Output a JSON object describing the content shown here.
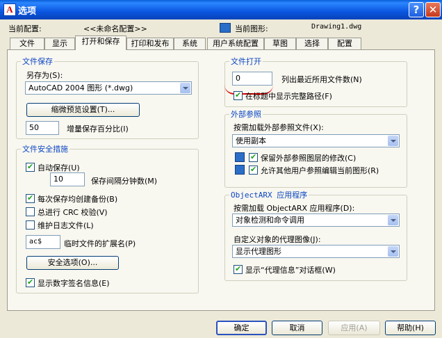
{
  "window": {
    "title": "选项",
    "icon_letter": "A"
  },
  "header": {
    "current_profile_label": "当前配置:",
    "current_profile_value": "<<未命名配置>>",
    "current_drawing_label": "当前图形:",
    "current_drawing_value": "Drawing1.dwg"
  },
  "tabs": [
    "文件",
    "显示",
    "打开和保存",
    "打印和发布",
    "系统",
    "用户系统配置",
    "草图",
    "选择",
    "配置"
  ],
  "file_save": {
    "title": "文件保存",
    "save_as_label": "另存为(S):",
    "save_as_value": "AutoCAD 2004 图形 (*.dwg)",
    "thumbnail_button": "缩微预览设置(T)...",
    "incremental_value": "50",
    "incremental_label": "增量保存百分比(I)"
  },
  "file_safety": {
    "title": "文件安全措施",
    "autosave_label": "自动保存(U)",
    "autosave_checked": true,
    "minutes_value": "10",
    "minutes_label": "保存间隔分钟数(M)",
    "backup_label": "每次保存均创建备份(B)",
    "backup_checked": true,
    "crc_label": "总进行 CRC 校验(V)",
    "crc_checked": false,
    "log_label": "维护日志文件(L)",
    "log_checked": false,
    "temp_ext_value": "ac$",
    "temp_ext_label": "临时文件的扩展名(P)",
    "security_button": "安全选项(O)...",
    "digital_sig_label": "显示数字签名信息(E)",
    "digital_sig_checked": true
  },
  "file_open": {
    "title": "文件打开",
    "recent_value": "0",
    "recent_label": "列出最近所用文件数(N)",
    "fullpath_label": "在标题中显示完整路径(F)",
    "fullpath_checked": true
  },
  "xref": {
    "title": "外部参照",
    "demand_load_label": "按需加载外部参照文件(X):",
    "demand_load_value": "使用副本",
    "retain_label": "保留外部参照图层的修改(C)",
    "retain_checked": true,
    "allow_edit_label": "允许其他用户参照编辑当前图形(R)",
    "allow_edit_checked": true
  },
  "objectarx": {
    "title": "ObjectARX 应用程序",
    "demand_load_label": "按需加载 ObjectARX 应用程序(D):",
    "demand_load_value": "对象检测和命令调用",
    "proxy_images_label": "自定义对象的代理图像(J):",
    "proxy_images_value": "显示代理图形",
    "proxy_info_label": "显示“代理信息”对话框(W)",
    "proxy_info_checked": true
  },
  "buttons": {
    "ok": "确定",
    "cancel": "取消",
    "apply": "应用(A)",
    "help": "帮助(H)"
  }
}
